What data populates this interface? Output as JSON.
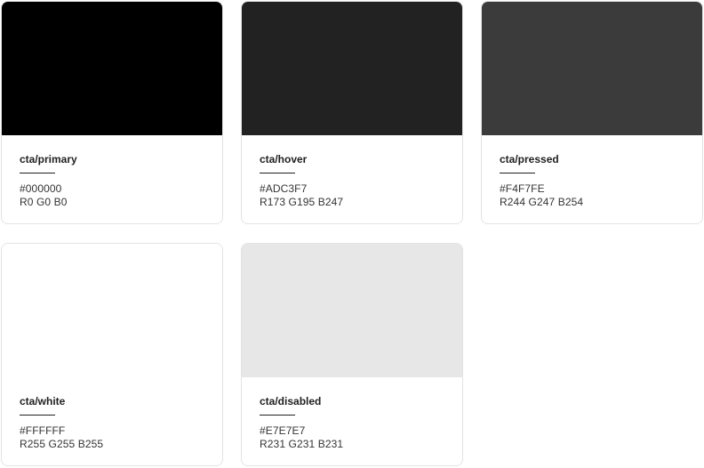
{
  "swatches": [
    {
      "name": "cta/primary",
      "hex": "#000000",
      "rgb": "R0 G0 B0",
      "display_color": "#000000"
    },
    {
      "name": "cta/hover",
      "hex": "#ADC3F7",
      "rgb": "R173 G195 B247",
      "display_color": "#222222"
    },
    {
      "name": "cta/pressed",
      "hex": "#F4F7FE",
      "rgb": "R244 G247 B254",
      "display_color": "#3b3b3b"
    },
    {
      "name": "cta/white",
      "hex": "#FFFFFF",
      "rgb": "R255 G255 B255",
      "display_color": "#ffffff"
    },
    {
      "name": "cta/disabled",
      "hex": "#E7E7E7",
      "rgb": "R231 G231 B231",
      "display_color": "#e7e7e7"
    }
  ]
}
